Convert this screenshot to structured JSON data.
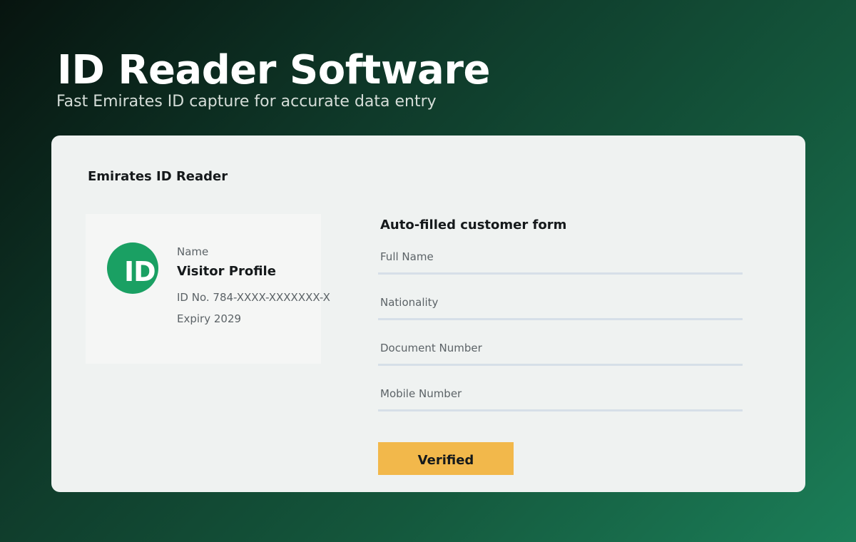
{
  "hero": {
    "title": "ID Reader Software",
    "subtitle": "Fast Emirates ID capture for accurate data entry"
  },
  "panel": {
    "title": "Emirates ID Reader"
  },
  "id_card": {
    "badge_text": "ID",
    "name_label": "Name",
    "name_value": "Visitor Profile",
    "id_number": "ID No. 784-XXXX-XXXXXXX-X",
    "expiry": "Expiry 2029",
    "badge_color": "#1aa063"
  },
  "form": {
    "title": "Auto-filled customer form",
    "fields": [
      {
        "label": "Full Name"
      },
      {
        "label": "Nationality"
      },
      {
        "label": "Document Number"
      },
      {
        "label": "Mobile Number"
      }
    ],
    "button_label": "Verified",
    "button_color": "#f2b84b"
  }
}
